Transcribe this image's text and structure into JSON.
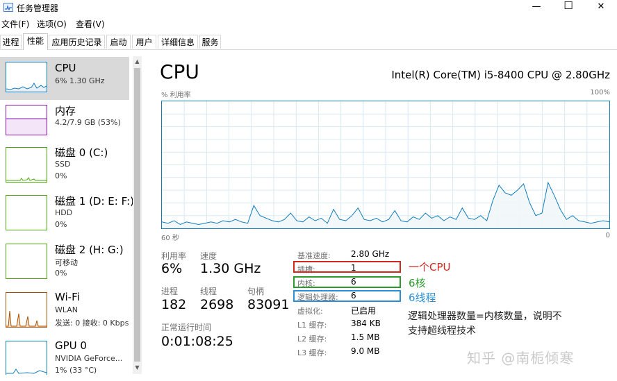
{
  "window": {
    "title": "任务管理器",
    "minimize_label": "—",
    "maximize_label": "☐",
    "close_label": "✕"
  },
  "menu": [
    {
      "label": "文件(F)"
    },
    {
      "label": "选项(O)"
    },
    {
      "label": "查看(V)"
    }
  ],
  "tabs": [
    {
      "label": "进程"
    },
    {
      "label": "性能",
      "active": true
    },
    {
      "label": "应用历史记录"
    },
    {
      "label": "启动"
    },
    {
      "label": "用户"
    },
    {
      "label": "详细信息"
    },
    {
      "label": "服务"
    }
  ],
  "sidebar": {
    "items": [
      {
        "title": "CPU",
        "line1": "6% 1.30 GHz",
        "color": "#117dbb",
        "selected": true
      },
      {
        "title": "内存",
        "line1": "4.2/7.9 GB (53%)",
        "color": "#8b12ae"
      },
      {
        "title": "磁盘 0 (C:)",
        "line1": "SSD",
        "line2": "0%",
        "color": "#4da60c"
      },
      {
        "title": "磁盘 1 (D: E: F:)",
        "line1": "HDD",
        "line2": "0%",
        "color": "#4da60c"
      },
      {
        "title": "磁盘 2 (H: G:)",
        "line1": "可移动",
        "line2": "0%",
        "color": "#4da60c"
      },
      {
        "title": "Wi-Fi",
        "line1": "WLAN",
        "line2": "发送: 0 接收: 0 Kbps",
        "color": "#a74f01"
      },
      {
        "title": "GPU 0",
        "line1": "NVIDIA GeForce...",
        "line2": "1% (33 °C)",
        "color": "#117dbb"
      }
    ]
  },
  "main": {
    "title": "CPU",
    "cpu_model": "Intel(R) Core(TM) i5-8400 CPU @ 2.80GHz",
    "graph": {
      "y_label": "% 利用率",
      "y_max_label": "100%",
      "x_left_label": "60 秒",
      "x_right_label": "0",
      "line_color": "#117dbb",
      "fill_color": "#f1f6fa",
      "series": [
        5,
        4,
        6,
        3,
        5,
        4,
        3,
        4,
        5,
        4,
        6,
        5,
        7,
        5,
        4,
        18,
        10,
        8,
        6,
        5,
        7,
        12,
        6,
        5,
        9,
        6,
        8,
        4,
        15,
        7,
        6,
        10,
        16,
        7,
        6,
        8,
        5,
        7,
        14,
        6,
        5,
        9,
        7,
        12,
        8,
        10,
        6,
        9,
        7,
        16,
        8,
        7,
        10,
        6,
        22,
        34,
        28,
        26,
        30,
        35,
        20,
        10,
        12,
        36,
        26,
        15,
        7,
        10,
        6,
        5,
        4,
        5,
        6,
        5
      ]
    },
    "stats": {
      "utilization": {
        "label": "利用率",
        "value": "6%"
      },
      "speed": {
        "label": "速度",
        "value": "1.30 GHz"
      },
      "processes": {
        "label": "进程",
        "value": "182"
      },
      "threads": {
        "label": "线程",
        "value": "2698"
      },
      "handles": {
        "label": "句柄",
        "value": "83091"
      },
      "uptime": {
        "label": "正常运行时间",
        "value": "0:01:08:25"
      }
    },
    "details": [
      {
        "label": "基准速度:",
        "value": "2.80 GHz"
      },
      {
        "label": "插槽:",
        "value": "1"
      },
      {
        "label": "内核:",
        "value": "6"
      },
      {
        "label": "逻辑处理器:",
        "value": "6"
      },
      {
        "label": "虚拟化:",
        "value": "已启用"
      },
      {
        "label": "L1 缓存:",
        "value": "384 KB"
      },
      {
        "label": "L2 缓存:",
        "value": "1.5 MB"
      },
      {
        "label": "L3 缓存:",
        "value": "9.0 MB"
      }
    ]
  },
  "annotations": {
    "socket": {
      "text": "一个CPU",
      "color": "#d0281e"
    },
    "cores": {
      "text": "6核",
      "color": "#2a9a2a"
    },
    "threads": {
      "text": "6线程",
      "color": "#2b8fd6"
    },
    "note_line1": "逻辑处理器数量=内核数量，说明不",
    "note_line2": "支持超线程技术"
  },
  "watermark": "知乎 @南栀倾寒"
}
